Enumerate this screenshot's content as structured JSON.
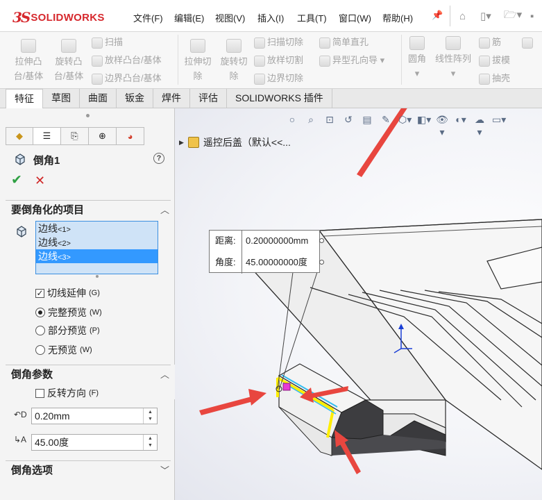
{
  "app": {
    "logo_mark": "3S",
    "logo_text": "SOLIDWORKS"
  },
  "menu": {
    "file": "文件(F)",
    "edit": "编辑(E)",
    "view": "视图(V)",
    "insert": "插入(I)",
    "tools": "工具(T)",
    "window": "窗口(W)",
    "help": "帮助(H)"
  },
  "ribbon": {
    "extrude_boss_1": "拉伸凸",
    "extrude_boss_2": "台/基体",
    "revolve_boss_1": "旋转凸",
    "revolve_boss_2": "台/基体",
    "sweep": "扫描",
    "loft": "放样凸台/基体",
    "boundary": "边界凸台/基体",
    "extrude_cut_1": "拉伸切",
    "extrude_cut_2": "除",
    "revolve_cut_1": "旋转切",
    "revolve_cut_2": "除",
    "swept_cut": "扫描切除",
    "lofted_cut": "放样切割",
    "boundary_cut": "边界切除",
    "simple_hole": "简单直孔",
    "hole_wizard": "异型孔向导",
    "fillet": "圆角",
    "linear_pattern": "线性阵列",
    "rib": "筋",
    "draft": "拔模",
    "shell": "抽壳"
  },
  "tabs": [
    "特征",
    "草图",
    "曲面",
    "钣金",
    "焊件",
    "评估",
    "SOLIDWORKS 插件"
  ],
  "tree": {
    "root": "遥控后盖（默认<<..."
  },
  "property_manager": {
    "title": "倒角1",
    "items_section": "要倒角化的项目",
    "edges": [
      {
        "name": "边线",
        "tag": "<1>"
      },
      {
        "name": "边线",
        "tag": "<2>"
      },
      {
        "name": "边线",
        "tag": "<3>"
      }
    ],
    "tangent_propagation": {
      "label": "切线延伸",
      "key": "(G)",
      "checked": true
    },
    "full_preview": {
      "label": "完整预览",
      "key": "(W)",
      "selected": true
    },
    "partial_preview": {
      "label": "部分预览",
      "key": "(P)",
      "selected": false
    },
    "no_preview": {
      "label": "无预览",
      "key": "(W)",
      "selected": false
    },
    "params_section": "倒角参数",
    "reverse_direction": {
      "label": "反转方向",
      "key": "(F)",
      "checked": false
    },
    "distance_value": "0.20mm",
    "angle_value": "45.00度",
    "options_section": "倒角选项"
  },
  "callout": {
    "distance_label": "距离:",
    "distance_value": "0.20000000mm",
    "angle_label": "角度:",
    "angle_value": "45.00000000度"
  },
  "colors": {
    "accent": "#3399ff",
    "arrow": "#e8463f",
    "brand": "#d6282d",
    "highlight": "#ffee00"
  }
}
